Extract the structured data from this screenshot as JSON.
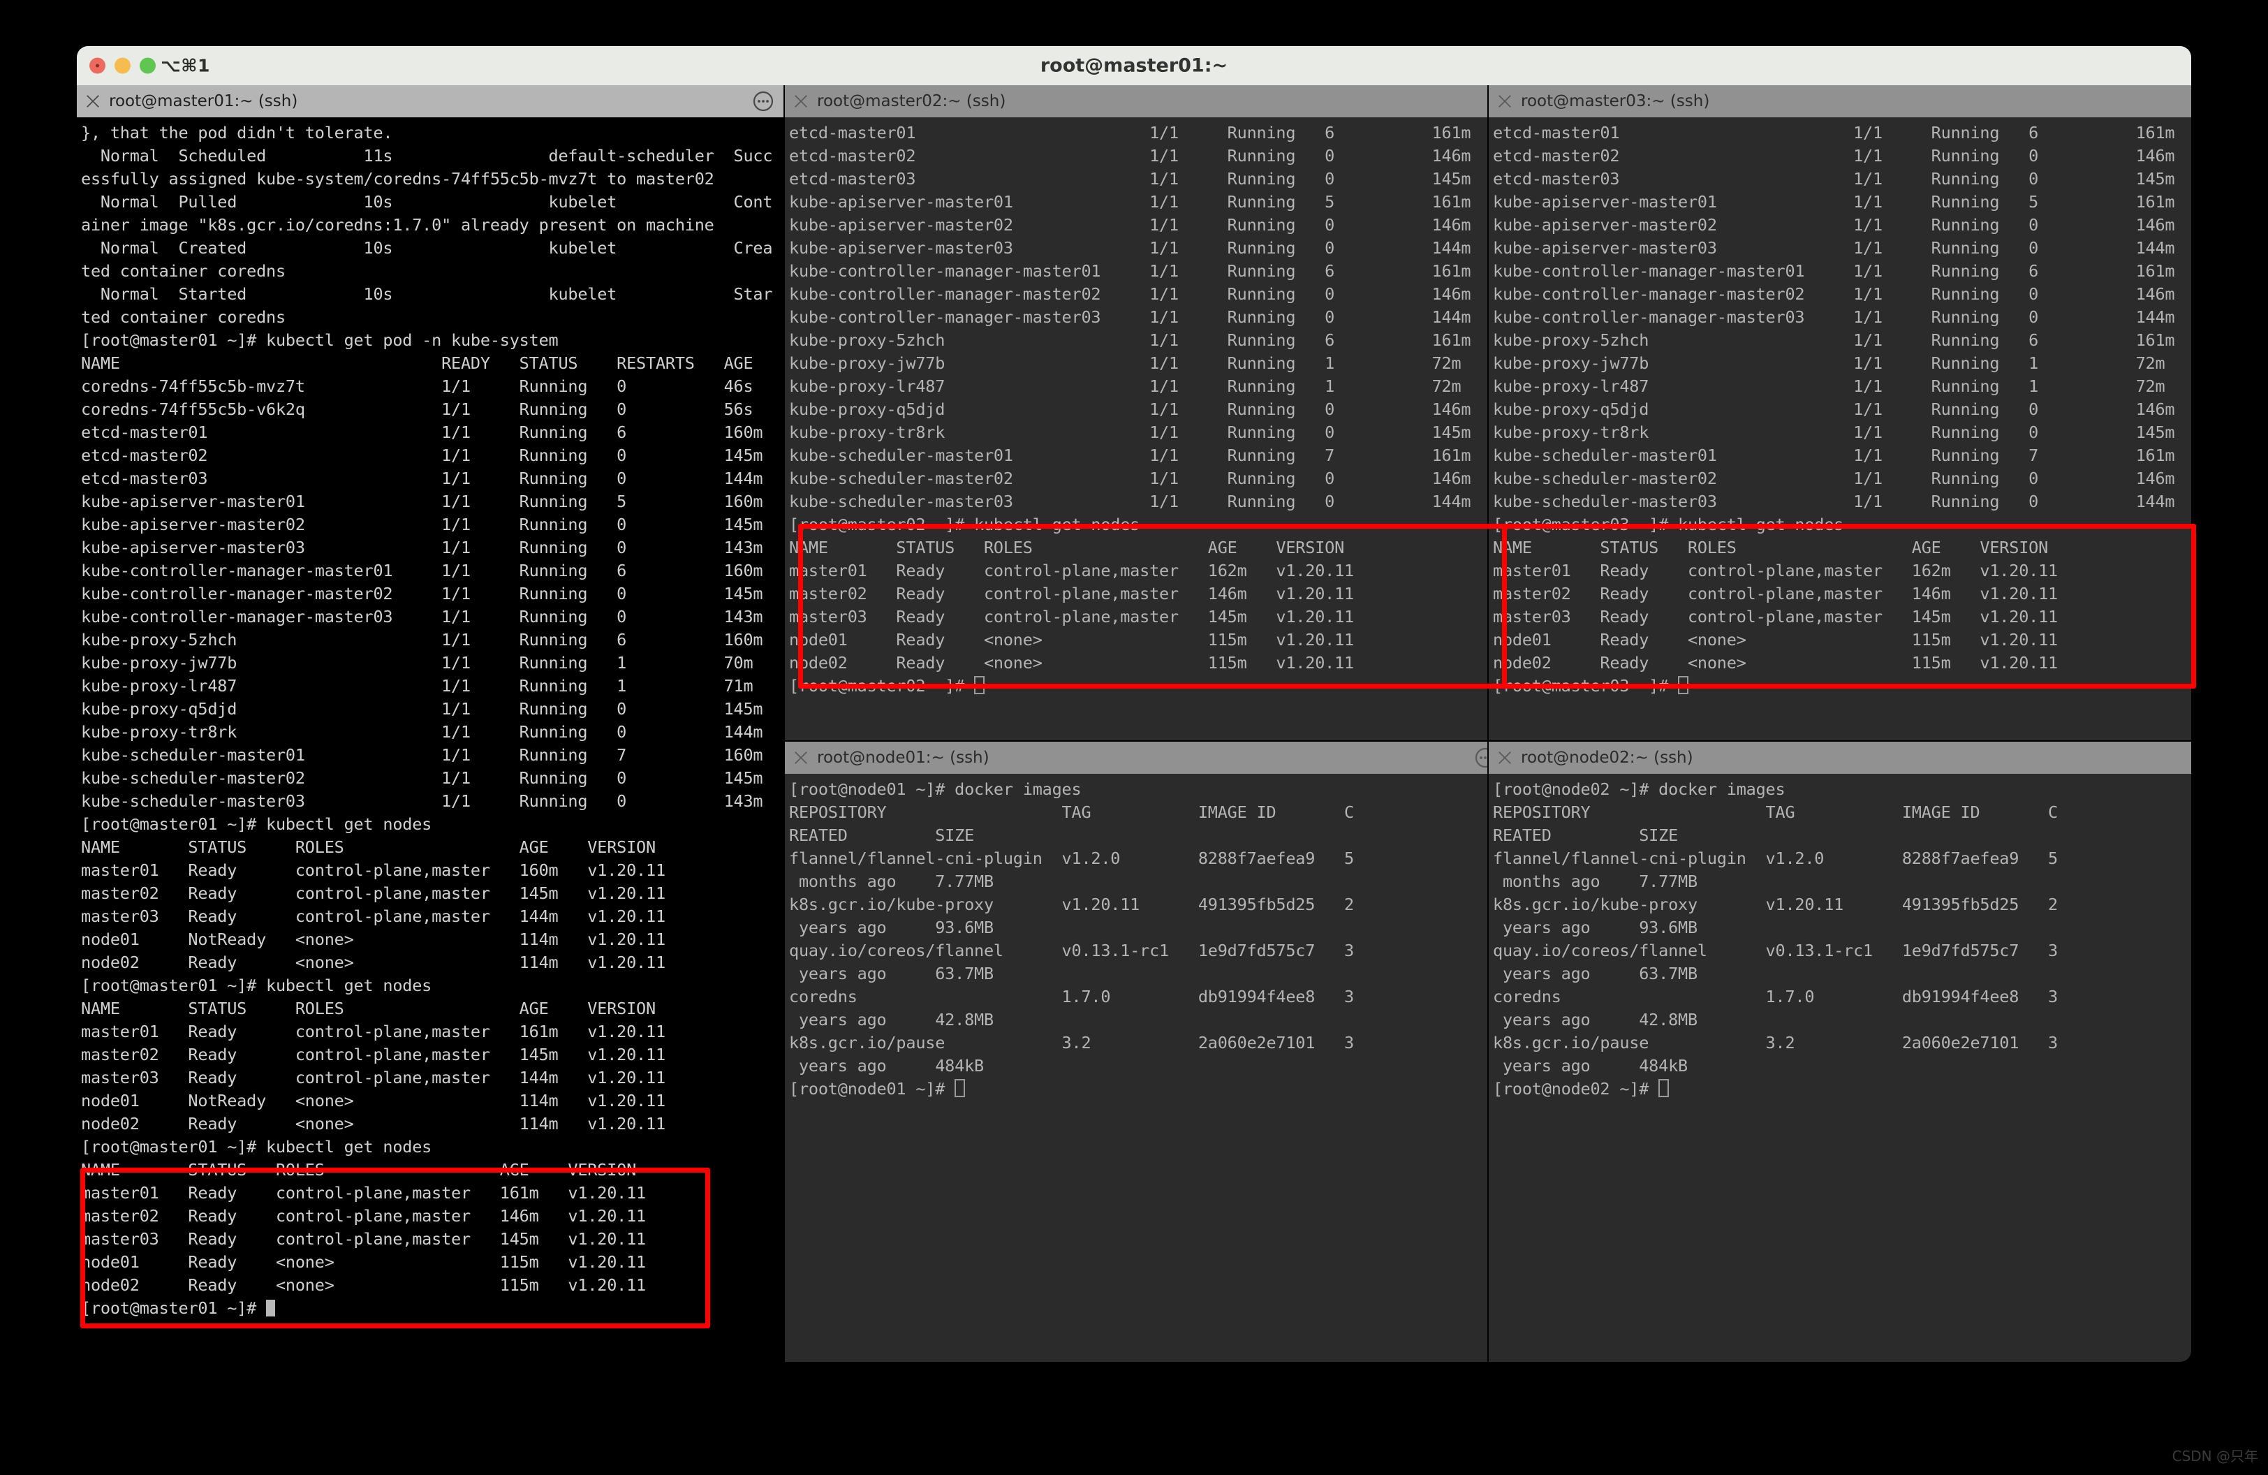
{
  "window": {
    "title": "root@master01:~",
    "shortcut_label": "⌥⌘1",
    "traffic_lights": [
      "close-button",
      "minimize-button",
      "maximize-button"
    ]
  },
  "watermark": "CSDN @只年",
  "panes": {
    "left": {
      "tab_title": "root@master01:~ (ssh)",
      "active": true,
      "content": "}, that the pod didn't tolerate.\n  Normal  Scheduled          11s                default-scheduler  Succ\nessfully assigned kube-system/coredns-74ff55c5b-mvz7t to master02\n  Normal  Pulled             10s                kubelet            Cont\nainer image \"k8s.gcr.io/coredns:1.7.0\" already present on machine\n  Normal  Created            10s                kubelet            Crea\nted container coredns\n  Normal  Started            10s                kubelet            Star\nted container coredns\n[root@master01 ~]# kubectl get pod -n kube-system\nNAME                                 READY   STATUS    RESTARTS   AGE\ncoredns-74ff55c5b-mvz7t              1/1     Running   0          46s\ncoredns-74ff55c5b-v6k2q              1/1     Running   0          56s\netcd-master01                        1/1     Running   6          160m\netcd-master02                        1/1     Running   0          145m\netcd-master03                        1/1     Running   0          144m\nkube-apiserver-master01              1/1     Running   5          160m\nkube-apiserver-master02              1/1     Running   0          145m\nkube-apiserver-master03              1/1     Running   0          143m\nkube-controller-manager-master01     1/1     Running   6          160m\nkube-controller-manager-master02     1/1     Running   0          145m\nkube-controller-manager-master03     1/1     Running   0          143m\nkube-proxy-5zhch                     1/1     Running   6          160m\nkube-proxy-jw77b                     1/1     Running   1          70m\nkube-proxy-lr487                     1/1     Running   1          71m\nkube-proxy-q5djd                     1/1     Running   0          145m\nkube-proxy-tr8rk                     1/1     Running   0          144m\nkube-scheduler-master01              1/1     Running   7          160m\nkube-scheduler-master02              1/1     Running   0          145m\nkube-scheduler-master03              1/1     Running   0          143m\n[root@master01 ~]# kubectl get nodes\nNAME       STATUS     ROLES                  AGE    VERSION\nmaster01   Ready      control-plane,master   160m   v1.20.11\nmaster02   Ready      control-plane,master   145m   v1.20.11\nmaster03   Ready      control-plane,master   144m   v1.20.11\nnode01     NotReady   <none>                 114m   v1.20.11\nnode02     Ready      <none>                 114m   v1.20.11\n[root@master01 ~]# kubectl get nodes\nNAME       STATUS     ROLES                  AGE    VERSION\nmaster01   Ready      control-plane,master   161m   v1.20.11\nmaster02   Ready      control-plane,master   145m   v1.20.11\nmaster03   Ready      control-plane,master   144m   v1.20.11\nnode01     NotReady   <none>                 114m   v1.20.11\nnode02     Ready      <none>                 114m   v1.20.11\n[root@master01 ~]# kubectl get nodes\nNAME       STATUS   ROLES                  AGE    VERSION\nmaster01   Ready    control-plane,master   161m   v1.20.11\nmaster02   Ready    control-plane,master   146m   v1.20.11\nmaster03   Ready    control-plane,master   145m   v1.20.11\nnode01     Ready    <none>                 115m   v1.20.11\nnode02     Ready    <none>                 115m   v1.20.11\n[root@master01 ~]# "
    },
    "master02": {
      "tab_title": "root@master02:~ (ssh)",
      "active": false,
      "content": "etcd-master01                        1/1     Running   6          161m\netcd-master02                        1/1     Running   0          146m\netcd-master03                        1/1     Running   0          145m\nkube-apiserver-master01              1/1     Running   5          161m\nkube-apiserver-master02              1/1     Running   0          146m\nkube-apiserver-master03              1/1     Running   0          144m\nkube-controller-manager-master01     1/1     Running   6          161m\nkube-controller-manager-master02     1/1     Running   0          146m\nkube-controller-manager-master03     1/1     Running   0          144m\nkube-proxy-5zhch                     1/1     Running   6          161m\nkube-proxy-jw77b                     1/1     Running   1          72m\nkube-proxy-lr487                     1/1     Running   1          72m\nkube-proxy-q5djd                     1/1     Running   0          146m\nkube-proxy-tr8rk                     1/1     Running   0          145m\nkube-scheduler-master01              1/1     Running   7          161m\nkube-scheduler-master02              1/1     Running   0          146m\nkube-scheduler-master03              1/1     Running   0          144m\n[root@master02 ~]# kubectl get nodes\nNAME       STATUS   ROLES                  AGE    VERSION\nmaster01   Ready    control-plane,master   162m   v1.20.11\nmaster02   Ready    control-plane,master   146m   v1.20.11\nmaster03   Ready    control-plane,master   145m   v1.20.11\nnode01     Ready    <none>                 115m   v1.20.11\nnode02     Ready    <none>                 115m   v1.20.11\n[root@master02 ~]# "
    },
    "master03": {
      "tab_title": "root@master03:~ (ssh)",
      "active": false,
      "content": "etcd-master01                        1/1     Running   6          161m\netcd-master02                        1/1     Running   0          146m\netcd-master03                        1/1     Running   0          145m\nkube-apiserver-master01              1/1     Running   5          161m\nkube-apiserver-master02              1/1     Running   0          146m\nkube-apiserver-master03              1/1     Running   0          144m\nkube-controller-manager-master01     1/1     Running   6          161m\nkube-controller-manager-master02     1/1     Running   0          146m\nkube-controller-manager-master03     1/1     Running   0          144m\nkube-proxy-5zhch                     1/1     Running   6          161m\nkube-proxy-jw77b                     1/1     Running   1          72m\nkube-proxy-lr487                     1/1     Running   1          72m\nkube-proxy-q5djd                     1/1     Running   0          146m\nkube-proxy-tr8rk                     1/1     Running   0          145m\nkube-scheduler-master01              1/1     Running   7          161m\nkube-scheduler-master02              1/1     Running   0          146m\nkube-scheduler-master03              1/1     Running   0          144m\n[root@master03 ~]# kubectl get nodes\nNAME       STATUS   ROLES                  AGE    VERSION\nmaster01   Ready    control-plane,master   162m   v1.20.11\nmaster02   Ready    control-plane,master   146m   v1.20.11\nmaster03   Ready    control-plane,master   145m   v1.20.11\nnode01     Ready    <none>                 115m   v1.20.11\nnode02     Ready    <none>                 115m   v1.20.11\n[root@master03 ~]# "
    },
    "node01": {
      "tab_title": "root@node01:~ (ssh)",
      "active": false,
      "content": "[root@node01 ~]# docker images\nREPOSITORY                  TAG           IMAGE ID       C\nREATED         SIZE\nflannel/flannel-cni-plugin  v1.2.0        8288f7aefea9   5\n months ago    7.77MB\nk8s.gcr.io/kube-proxy       v1.20.11      491395fb5d25   2\n years ago     93.6MB\nquay.io/coreos/flannel      v0.13.1-rc1   1e9d7fd575c7   3\n years ago     63.7MB\ncoredns                     1.7.0         db91994f4ee8   3\n years ago     42.8MB\nk8s.gcr.io/pause            3.2           2a060e2e7101   3\n years ago     484kB\n[root@node01 ~]# "
    },
    "node02": {
      "tab_title": "root@node02:~ (ssh)",
      "active": false,
      "content": "[root@node02 ~]# docker images\nREPOSITORY                  TAG           IMAGE ID       C\nREATED         SIZE\nflannel/flannel-cni-plugin  v1.2.0        8288f7aefea9   5\n months ago    7.77MB\nk8s.gcr.io/kube-proxy       v1.20.11      491395fb5d25   2\n years ago     93.6MB\nquay.io/coreos/flannel      v0.13.1-rc1   1e9d7fd575c7   3\n years ago     63.7MB\ncoredns                     1.7.0         db91994f4ee8   3\n years ago     42.8MB\nk8s.gcr.io/pause            3.2           2a060e2e7101   3\n years ago     484kB\n[root@node02 ~]# "
    }
  },
  "annotations": {
    "highlight_color": "#ff0000",
    "boxes": [
      {
        "name": "master01-get-nodes-result",
        "pane": "left"
      },
      {
        "name": "master02-get-nodes-result",
        "pane": "master02"
      },
      {
        "name": "master03-get-nodes-result",
        "pane": "master03"
      }
    ]
  }
}
